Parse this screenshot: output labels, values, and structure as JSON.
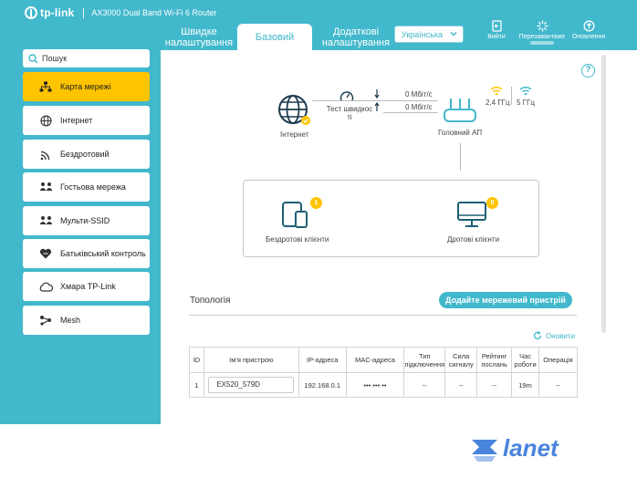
{
  "header": {
    "brand": "tp-link",
    "model": "AX3000 Dual Band Wi-Fi 6 Router",
    "tabs": [
      {
        "label": "Швидке налаштування"
      },
      {
        "label": "Базовий"
      },
      {
        "label": "Додаткові налаштування"
      }
    ],
    "language": "Українська",
    "actions": {
      "logout": "Вийти",
      "reboot": "Перезавантаже",
      "update": "Оновлення"
    }
  },
  "sidebar": {
    "search_placeholder": "Пошук",
    "items": [
      {
        "label": "Карта мережі",
        "icon": "network-map-icon",
        "active": true
      },
      {
        "label": "Інтернет",
        "icon": "globe-icon"
      },
      {
        "label": "Бездротовий",
        "icon": "wireless-icon"
      },
      {
        "label": "Гостьова мережа",
        "icon": "guest-network-icon"
      },
      {
        "label": "Мульти-SSID",
        "icon": "multi-ssid-icon"
      },
      {
        "label": "Батьківський контроль",
        "icon": "parental-control-icon"
      },
      {
        "label": "Хмара TP-Link",
        "icon": "cloud-icon"
      },
      {
        "label": "Mesh",
        "icon": "mesh-icon"
      }
    ]
  },
  "network_map": {
    "internet_label": "Інтернет",
    "speed_test_label": "Тест швидкос ті",
    "download_speed": "0 Мбіт/с",
    "upload_speed": "0 Мбіт/с",
    "router_label": "Головний АП",
    "band_24": "2,4 ГГц",
    "band_5": "5 ГГц",
    "wireless_clients_label": "Бездротові клієнти",
    "wireless_clients_count": "1",
    "wired_clients_label": "Дротові клієнти",
    "wired_clients_count": "0"
  },
  "topology": {
    "title": "Топологія",
    "add_button": "Додайте мережевий пристрій",
    "refresh_label": "Оновити",
    "columns": [
      "ID",
      "Ім'я пристрою",
      "IP-адреса",
      "MAC-адреса",
      "Тип підключення",
      "Сила сигналу",
      "Рейтинг послань",
      "Час роботи",
      "Операція"
    ],
    "rows": [
      {
        "id": "1",
        "name": "EX520_579D",
        "ip": "192.168.0.1",
        "mac": "••• ••• ••",
        "type": "--",
        "signal": "--",
        "rating": "--",
        "uptime": "19m",
        "operation": "--"
      }
    ]
  },
  "footer": {
    "brand": "lanet"
  },
  "colors": {
    "accent": "#42b8cc",
    "active": "#ffc400",
    "lanet": "#2a6fd6"
  }
}
